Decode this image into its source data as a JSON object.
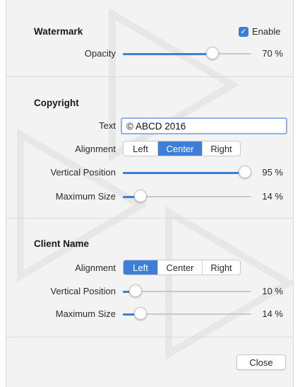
{
  "watermark": {
    "title": "Watermark",
    "enable_label": "Enable",
    "enable_checked": true,
    "opacity": {
      "label": "Opacity",
      "value": 0.7,
      "value_text": "70 %"
    }
  },
  "copyright": {
    "title": "Copyright",
    "text_label": "Text",
    "text_value": "© ABCD 2016",
    "alignment_label": "Alignment",
    "alignment_options": [
      "Left",
      "Center",
      "Right"
    ],
    "alignment_selected": "Center",
    "vertical": {
      "label": "Vertical Position",
      "value": 0.95,
      "value_text": "95 %"
    },
    "max_size": {
      "label": "Maximum Size",
      "value": 0.14,
      "value_text": "14 %"
    }
  },
  "client_name": {
    "title": "Client Name",
    "alignment_label": "Alignment",
    "alignment_options": [
      "Left",
      "Center",
      "Right"
    ],
    "alignment_selected": "Left",
    "vertical": {
      "label": "Vertical Position",
      "value": 0.1,
      "value_text": "10 %"
    },
    "max_size": {
      "label": "Maximum Size",
      "value": 0.14,
      "value_text": "14 %"
    }
  },
  "footer": {
    "close_label": "Close"
  },
  "colors": {
    "accent": "#3d7fd8",
    "panel_bg": "#f3f3f3"
  }
}
